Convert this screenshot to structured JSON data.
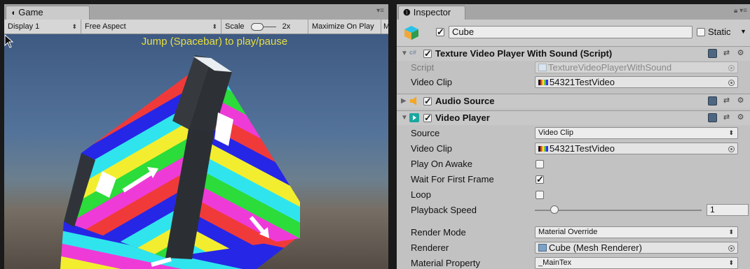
{
  "game_window": {
    "tab_label": "Game",
    "toolbar": {
      "display": "Display 1",
      "aspect": "Free Aspect",
      "scale_label": "Scale",
      "scale_value": "2x",
      "maximize_on_play": "Maximize On Play",
      "truncated_button": "Mu"
    },
    "overlay_text": "Jump (Spacebar) to play/pause"
  },
  "inspector": {
    "tab_label": "Inspector",
    "object": {
      "name": "Cube",
      "active": true,
      "static_label": "Static",
      "static": false
    },
    "components": {
      "script_component": {
        "title": "Texture Video Player With Sound (Script)",
        "enabled": true,
        "script_label": "Script",
        "script_value": "TextureVideoPlayerWithSound",
        "video_clip_label": "Video Clip",
        "video_clip_value": "54321TestVideo"
      },
      "audio_source": {
        "title": "Audio Source",
        "enabled": true,
        "expanded": false
      },
      "video_player": {
        "title": "Video Player",
        "enabled": true,
        "source_label": "Source",
        "source_value": "Video Clip",
        "video_clip_label": "Video Clip",
        "video_clip_value": "54321TestVideo",
        "play_on_awake_label": "Play On Awake",
        "play_on_awake": false,
        "wait_first_frame_label": "Wait For First Frame",
        "wait_first_frame": true,
        "loop_label": "Loop",
        "loop": false,
        "playback_speed_label": "Playback Speed",
        "playback_speed": "1",
        "render_mode_label": "Render Mode",
        "render_mode_value": "Material Override",
        "renderer_label": "Renderer",
        "renderer_value": "Cube (Mesh Renderer)",
        "material_property_label": "Material Property",
        "material_property_value": "_MainTex"
      }
    }
  },
  "colors": {
    "overlay_text": "#e9df3f",
    "panel_bg": "#c2c2c2",
    "cube_stripes": [
      "#f2ee2f",
      "#2bdc3a",
      "#ee3bd8",
      "#f03a3a",
      "#2626e6",
      "#30e4ee",
      "#ffffff"
    ]
  }
}
